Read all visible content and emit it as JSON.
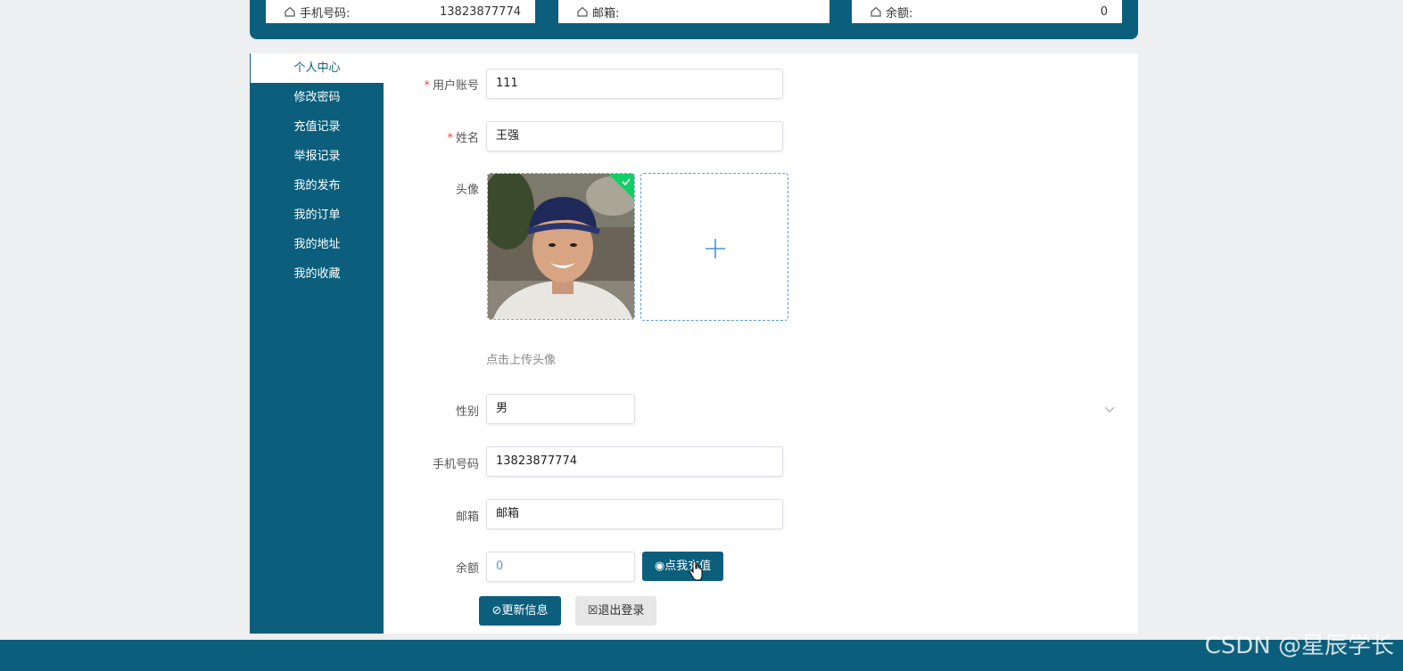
{
  "header": {
    "phone_label": "手机号码:",
    "phone_value": "13823877774",
    "email_label": "邮箱:",
    "email_value": "",
    "balance_label": "余额:",
    "balance_value": "0"
  },
  "sidebar": {
    "items": [
      {
        "label": "个人中心",
        "active": true
      },
      {
        "label": "修改密码"
      },
      {
        "label": "充值记录"
      },
      {
        "label": "举报记录"
      },
      {
        "label": "我的发布"
      },
      {
        "label": "我的订单"
      },
      {
        "label": "我的地址"
      },
      {
        "label": "我的收藏"
      }
    ]
  },
  "form": {
    "account_label": "用户账号",
    "account_value": "111",
    "name_label": "姓名",
    "name_value": "王强",
    "avatar_label": "头像",
    "avatar_hint": "点击上传头像",
    "gender_label": "性别",
    "gender_value": "男",
    "phone_label": "手机号码",
    "phone_value": "13823877774",
    "email_label": "邮箱",
    "email_value": "邮箱",
    "balance_label": "余额",
    "balance_value": "0",
    "recharge_button": "点我充值",
    "update_button": "更新信息",
    "logout_button": "退出登录"
  },
  "watermark": "CSDN @星辰学长",
  "colors": {
    "primary": "#0b5f7d",
    "required": "#e84a4a",
    "upload_border": "#5b9bd5"
  }
}
